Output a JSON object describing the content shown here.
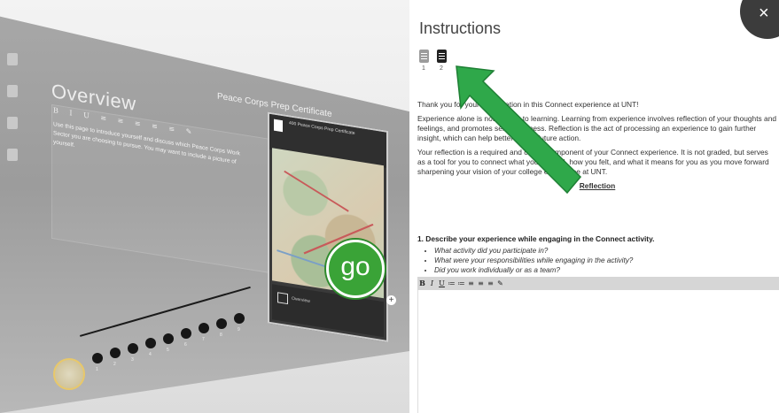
{
  "preview": {
    "overview_title": "Overview",
    "certificate_title": "Peace Corps Prep Certificate",
    "editor_toolbar": "B I U ≡ ≡ ≡ ≡ ≡ ✎",
    "overview_text": "Use this page to introduce yourself and discuss which Peace Corps Work Sector you are choosing to pursue. You may want to include a picture of yourself.",
    "card_header": "400\nPeace Corps Prep Certificate",
    "card_footer": "Overview",
    "go_label": "go",
    "add_label": "+",
    "timeline_numbers": [
      "1",
      "2",
      "3",
      "4",
      "5",
      "6",
      "7",
      "8",
      "9"
    ]
  },
  "instructions": {
    "title": "Instructions",
    "close_label": "×",
    "steps": [
      {
        "number": "1",
        "icon": "document-icon",
        "active": false
      },
      {
        "number": "2",
        "icon": "document-icon",
        "active": true
      }
    ],
    "p1": "Thank you for your participation in this Connect experience at UNT!",
    "p2": "Experience alone is not the key to learning. Learning from experience involves reflection of your thoughts and feelings, and promotes self-awareness. Reflection is the act of processing an experience to gain further insight, which can help better inform future action.",
    "p3": "Your reflection is a required and critical component of your Connect experience. It is not graded, but serves as a tool for you to connect what you learned, how you felt, and what it means for you as you move forward sharpening your vision of your college experience at UNT.",
    "reflection_heading": "Reflection",
    "question_title": "1. Describe your experience while engaging in the Connect activity.",
    "question_bullets": [
      "What activity did you participate in?",
      "What were your responsibilities while engaging in the activity?",
      "Did you work individually or as a team?"
    ],
    "toolbar_buttons": [
      "B",
      "I",
      "U",
      "≔",
      "≔",
      "≡",
      "≡",
      "≡",
      "✎"
    ]
  },
  "colors": {
    "accent_green": "#3aa337",
    "arrow_green": "#2fa84a",
    "close_bg": "#3c3c3c"
  }
}
